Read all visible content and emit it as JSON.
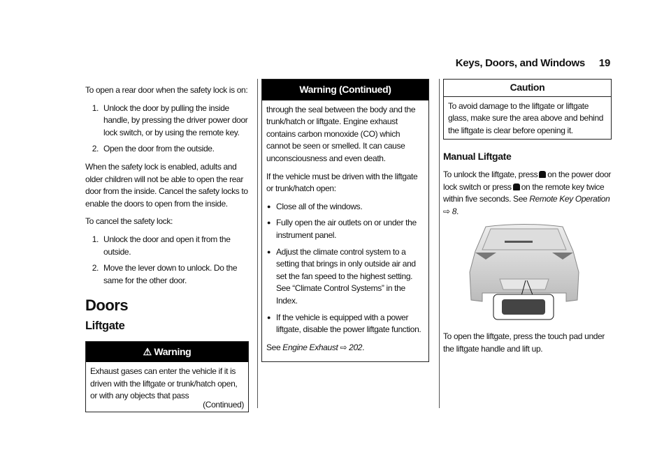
{
  "header": {
    "section": "Keys, Doors, and Windows",
    "page": "19"
  },
  "col1": {
    "intro": "To open a rear door when the safety lock is on:",
    "steps_open": [
      "Unlock the door by pulling the inside handle, by pressing the driver power door lock switch, or by using the remote key.",
      "Open the door from the outside."
    ],
    "para_enabled": "When the safety lock is enabled, adults and older children will not be able to open the rear door from the inside. Cancel the safety locks to enable the doors to open from the inside.",
    "cancel_intro": "To cancel the safety lock:",
    "steps_cancel": [
      "Unlock the door and open it from the outside.",
      "Move the lever down to unlock. Do the same for the other door."
    ],
    "heading_doors": "Doors",
    "heading_liftgate": "Liftgate",
    "warning": {
      "icon": "warning-triangle-icon",
      "title": "Warning",
      "body": "Exhaust gases can enter the vehicle if it is driven with the liftgate or trunk/hatch open, or with any objects that pass",
      "continued": "(Continued)"
    }
  },
  "col2": {
    "warning_title": "Warning  (Continued)",
    "body1": "through the seal between the body and the trunk/hatch or liftgate. Engine exhaust contains carbon monoxide (CO) which cannot be seen or smelled. It can cause unconsciousness and even death.",
    "body2": "If the vehicle must be driven with the liftgate or trunk/hatch open:",
    "bullets": [
      "Close all of the windows.",
      "Fully open the air outlets on or under the instrument panel.",
      "Adjust the climate control system to a setting that brings in only outside air and set the fan speed to the highest setting. See “Climate Control Systems” in the Index.",
      "If the vehicle is equipped with a power liftgate, disable the power liftgate function."
    ],
    "see_prefix": "See ",
    "see_link": "Engine Exhaust",
    "see_page": "202"
  },
  "col3": {
    "caution_title": "Caution",
    "caution_body": "To avoid damage to the liftgate or liftgate glass, make sure the area above and behind the liftgate is clear before opening it.",
    "heading_manual": "Manual Liftgate",
    "p1_a": "To unlock the liftgate, press",
    "p1_b": "on the power door lock switch or press",
    "p1_c": "on the remote key twice within five seconds. See ",
    "p1_link": "Remote Key Operation",
    "p1_page": "8",
    "lock_icon": "unlock-icon",
    "figure": "liftgate-touch-pad-illustration",
    "p2": "To open the liftgate, press the touch pad under the liftgate handle and lift up."
  }
}
